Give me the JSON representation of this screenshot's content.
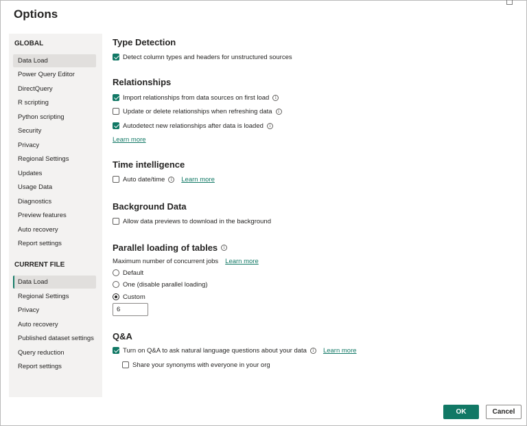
{
  "dialog": {
    "title": "Options",
    "ok_label": "OK",
    "cancel_label": "Cancel"
  },
  "sidebar": {
    "global_heading": "GLOBAL",
    "global_items": [
      {
        "label": "Data Load",
        "selected": true
      },
      {
        "label": "Power Query Editor"
      },
      {
        "label": "DirectQuery"
      },
      {
        "label": "R scripting"
      },
      {
        "label": "Python scripting"
      },
      {
        "label": "Security"
      },
      {
        "label": "Privacy"
      },
      {
        "label": "Regional Settings"
      },
      {
        "label": "Updates"
      },
      {
        "label": "Usage Data"
      },
      {
        "label": "Diagnostics"
      },
      {
        "label": "Preview features"
      },
      {
        "label": "Auto recovery"
      },
      {
        "label": "Report settings"
      }
    ],
    "current_heading": "CURRENT FILE",
    "current_items": [
      {
        "label": "Data Load",
        "selected": true
      },
      {
        "label": "Regional Settings"
      },
      {
        "label": "Privacy"
      },
      {
        "label": "Auto recovery"
      },
      {
        "label": "Published dataset settings"
      },
      {
        "label": "Query reduction"
      },
      {
        "label": "Report settings"
      }
    ]
  },
  "type_detection": {
    "title": "Type Detection",
    "detect_label": "Detect column types and headers for unstructured sources",
    "detect_checked": true
  },
  "relationships": {
    "title": "Relationships",
    "import_label": "Import relationships from data sources on first load",
    "import_checked": true,
    "update_label": "Update or delete relationships when refreshing data",
    "update_checked": false,
    "autodetect_label": "Autodetect new relationships after data is loaded",
    "autodetect_checked": true,
    "learn_more": "Learn more"
  },
  "time_intelligence": {
    "title": "Time intelligence",
    "auto_label": "Auto date/time",
    "auto_checked": false,
    "learn_more": "Learn more"
  },
  "background_data": {
    "title": "Background Data",
    "allow_label": "Allow data previews to download in the background",
    "allow_checked": false
  },
  "parallel_loading": {
    "title": "Parallel loading of tables",
    "max_label": "Maximum number of concurrent jobs",
    "learn_more": "Learn more",
    "options": [
      "Default",
      "One (disable parallel loading)",
      "Custom"
    ],
    "selected": "Custom",
    "custom_value": "6"
  },
  "qna": {
    "title": "Q&A",
    "turn_on_label": "Turn on Q&A to ask natural language questions about your data",
    "turn_on_checked": true,
    "learn_more": "Learn more",
    "share_label": "Share your synonyms with everyone in your org",
    "share_checked": false
  },
  "colors": {
    "accent": "#117865",
    "sidebar_bg": "#f3f2f1",
    "selected_bg": "#e1dfdd"
  }
}
